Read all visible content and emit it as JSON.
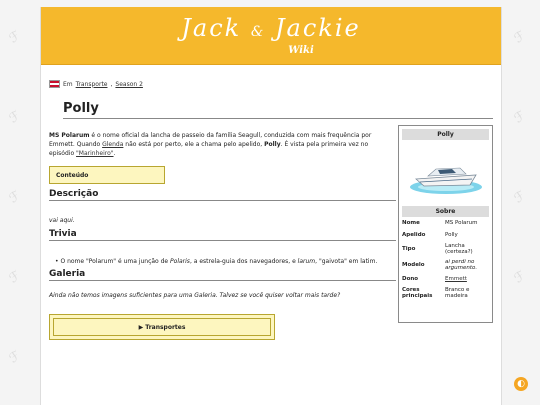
{
  "header": {
    "logo_left": "Jack",
    "logo_amp": "&",
    "logo_right": "Jackie",
    "logo_sub": "Wiki"
  },
  "breadcrumb": {
    "prefix": "Em",
    "link1": "Transporte",
    "sep": ",",
    "link2": "Season 2"
  },
  "page": {
    "title": "Polly",
    "intro": {
      "bold_name": "MS Polarum",
      "text1": " é o nome oficial da lancha de passeio da família Seagull, conduzida com mais frequência por Emmett. Quando ",
      "link_glenda": "Glenda",
      "text2": " não está por perto, ele a chama pelo apelido, ",
      "bold_polly": "Polly",
      "text3": ". É vista pela primeira vez no episódio ",
      "link_episode": "\"Marinheiro\"",
      "text4": "."
    },
    "toc_label": "Conteúdo",
    "sections": {
      "descricao_title": "Descrição",
      "descricao_text": "vai aqui.",
      "trivia_title": "Trivia",
      "trivia_text1": "O nome \"Polarum\" é uma junção de ",
      "trivia_italic1": "Polaris",
      "trivia_text2": ", a estrela-guia dos navegadores, e ",
      "trivia_italic2": "larum",
      "trivia_text3": ", \"gaivota\" em latim.",
      "galeria_title": "Galeria",
      "galeria_text": "Ainda não temos imagens suficientes para uma Galeria. Talvez se você quiser voltar mais tarde?"
    },
    "collapsible_label": "▶ Transportes"
  },
  "infobox": {
    "title": "Polly",
    "section": "Sobre",
    "rows": [
      {
        "label": "Nome",
        "value": "MS Polarum"
      },
      {
        "label": "Apelido",
        "value": "Polly"
      },
      {
        "label": "Tipo",
        "value": "Lancha (certeza?)"
      },
      {
        "label": "Modelo",
        "value": "ai perdi no argumento."
      },
      {
        "label": "Dono",
        "value": "Emmett"
      },
      {
        "label": "Cores principais",
        "value": "Branco e madeira"
      }
    ]
  },
  "colors": {
    "header": "#f5b82c",
    "toc_bg": "#fdf6bf",
    "toggle": "#f5a623"
  },
  "icons": {
    "flag": "us-flag-icon",
    "toggle": "theme-toggle-icon"
  }
}
